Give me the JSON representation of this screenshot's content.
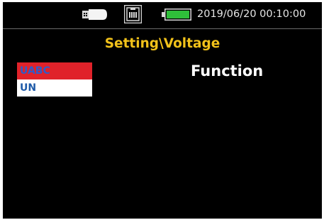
{
  "status_bar": {
    "usb_icon": "usb-drive-icon",
    "network_icon": "ethernet-port-icon",
    "battery_icon": "battery-icon",
    "battery_color": "#2fbf3a",
    "datetime": "2019/06/20 00:10:00"
  },
  "page": {
    "title": "Setting\\Voltage",
    "title_color": "#f2c21a",
    "function_label": "Function"
  },
  "options": {
    "selected_index": 0,
    "items": [
      {
        "label": "UABC",
        "selected": true
      },
      {
        "label": "UN",
        "selected": false
      }
    ],
    "selected_bg": "#e0222a",
    "normal_bg": "#ffffff"
  }
}
